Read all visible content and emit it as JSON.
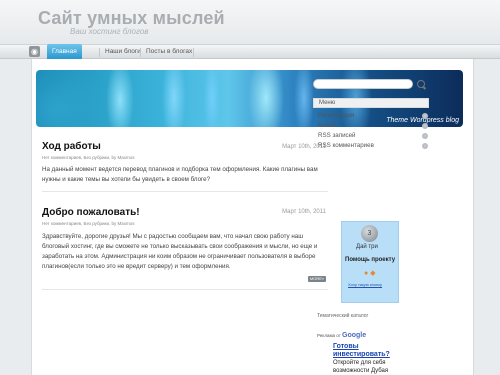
{
  "site": {
    "title": "Сайт умных мыслей",
    "tagline": "Ваш хостинг блогов"
  },
  "nav": {
    "items": [
      {
        "label": "Главная",
        "active": true
      },
      {
        "label": "Наши блоги",
        "active": false
      },
      {
        "label": "Посты в блогах",
        "active": false
      }
    ],
    "rss_icon": "rss-icon"
  },
  "header": {
    "credit": "Theme Wordpress blog"
  },
  "posts": [
    {
      "title": "Ход работы",
      "date": "Март 10th, 2011",
      "meta": "Нет комментариев, Без рубрики, by Maxmos",
      "body": "На данный момент ведется перевод плагинов и подборка тем оформления. Какие плагины вам нужны и какие темы вы хотели бы увидеть в своем блоге?"
    },
    {
      "title": "Добро пожаловать!",
      "date": "Март 10th, 2011",
      "meta": "Нет комментариев, Без рубрики, by Maxmos",
      "body": "Здравствуйте, дорогие друзья! Мы с радостью сообщаем вам, что начал свою работу наш блоговый хостинг, где вы сможете не только высказывать свои соображения и мысли, но еще и заработать на этом. Администрация ни коим образом не ограничивает пользователя в выборе плагинов(если только это не вредит серверу) и тем оформления.",
      "more_label": "MORE»"
    }
  ],
  "sidebar": {
    "search_icon": "search-icon",
    "widget_title": "Меню",
    "links": [
      "Регистрация",
      "Войти",
      "RSS записей",
      "RSS комментариев"
    ],
    "donate": {
      "give": "Дай три",
      "help": "Помощь проекту",
      "link": "Хочу такую кнопку"
    },
    "catalog": "Тематический каталог",
    "ad": {
      "header_text": "Реклама от",
      "brand": "Google",
      "link": "Готовы инвестировать?",
      "text": "Откройте для себя возможности Дубая"
    }
  }
}
